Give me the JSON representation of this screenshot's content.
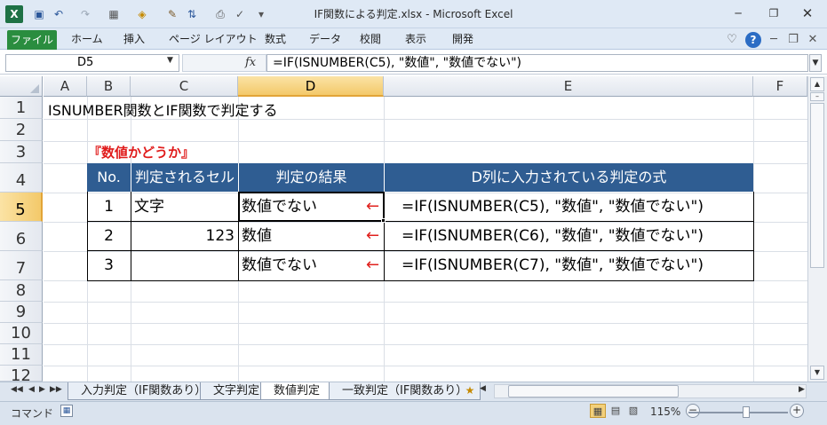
{
  "window": {
    "title": "IF関数による判定.xlsx - Microsoft Excel"
  },
  "ribbon": {
    "file_tab": "ファイル",
    "tabs": [
      "ホーム",
      "挿入",
      "ページ レイアウト",
      "数式",
      "データ",
      "校閲",
      "表示",
      "開発"
    ]
  },
  "formula_bar": {
    "name_box": "D5",
    "fx_label": "fx",
    "formula": "=IF(ISNUMBER(C5), \"数値\", \"数値でない\")"
  },
  "columns": [
    "A",
    "B",
    "C",
    "D",
    "E",
    "F"
  ],
  "selected_column": "D",
  "rows": [
    "1",
    "2",
    "3",
    "4",
    "5",
    "6",
    "7",
    "8",
    "9",
    "10",
    "11",
    "12"
  ],
  "selected_row": "5",
  "sheet": {
    "a1_text": "ISNUMBER関数とIF関数で判定する",
    "section_title": "『数値かどうか』",
    "table": {
      "headers": [
        "No.",
        "判定されるセル",
        "判定の結果",
        "D列に入力されている判定の式"
      ],
      "rows": [
        {
          "no": "1",
          "cell": "文字",
          "result": "数値でない",
          "formula": "=IF(ISNUMBER(C5), \"数値\", \"数値でない\")"
        },
        {
          "no": "2",
          "cell": "123",
          "result": "数値",
          "formula": "=IF(ISNUMBER(C6), \"数値\", \"数値でない\")"
        },
        {
          "no": "3",
          "cell": "",
          "result": "数値でない",
          "formula": "=IF(ISNUMBER(C7), \"数値\", \"数値でない\")"
        }
      ],
      "arrow_glyph": "←",
      "header_color": "#2f5d92",
      "arrow_color": "#e0201d"
    }
  },
  "sheet_tabs": {
    "tabs": [
      "入力判定（IF関数あり）",
      "文字判定",
      "数値判定",
      "一致判定（IF関数あり）"
    ],
    "active": "数値判定"
  },
  "status_bar": {
    "mode": "コマンド",
    "zoom": "115%"
  }
}
